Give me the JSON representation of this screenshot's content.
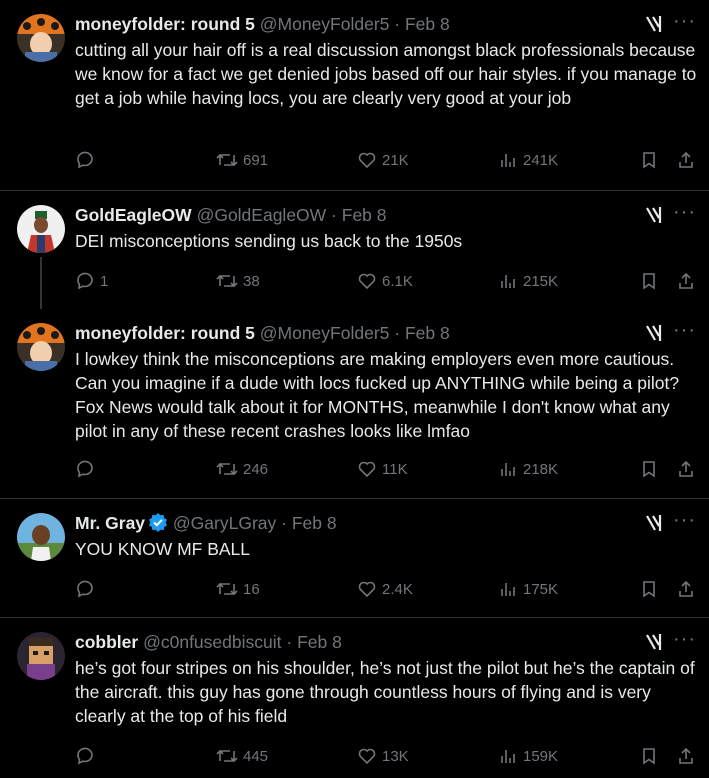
{
  "tweets": [
    {
      "name": "moneyfolder: round 5",
      "handle": "@MoneyFolder5",
      "date": "Feb 8",
      "text": "cutting all your hair off is a real discussion amongst black professionals because we know for a fact we get denied jobs based off our hair styles. if you manage to get a job while having locs, you are clearly very good at your job",
      "replies": "",
      "retweets": "691",
      "likes": "21K",
      "views": "241K"
    },
    {
      "name": "GoldEagleOW",
      "handle": "@GoldEagleOW",
      "date": "Feb 8",
      "text": "DEI misconceptions sending us back to the 1950s",
      "replies": "1",
      "retweets": "38",
      "likes": "6.1K",
      "views": "215K"
    },
    {
      "name": "moneyfolder: round 5",
      "handle": "@MoneyFolder5",
      "date": "Feb 8",
      "text": "I lowkey think the misconceptions are making employers even more cautious. Can you imagine if a dude with locs fucked up ANYTHING while being a pilot? Fox News would talk about it for MONTHS, meanwhile I don't know what any pilot in any of these recent crashes looks like lmfao",
      "replies": "",
      "retweets": "246",
      "likes": "11K",
      "views": "218K"
    },
    {
      "name": "Mr. Gray",
      "handle": "@GaryLGray",
      "date": "Feb 8",
      "text": "YOU KNOW MF BALL",
      "replies": "",
      "retweets": "16",
      "likes": "2.4K",
      "views": "175K"
    },
    {
      "name": "cobbler",
      "handle": "@c0nfusedbiscuit",
      "date": "Feb 8",
      "text": "he’s got four stripes on his shoulder, he’s not just the pilot but he’s the captain of the aircraft. this guy has gone through countless hours of flying and is very clearly at the top of his field",
      "replies": "",
      "retweets": "445",
      "likes": "13K",
      "views": "159K"
    }
  ],
  "separator": " · ",
  "more_label": "···",
  "colors": {
    "background": "#000000",
    "text": "#e7e9ea",
    "muted": "#71767b",
    "border": "#2f3336",
    "verified": "#1d9bf0"
  }
}
